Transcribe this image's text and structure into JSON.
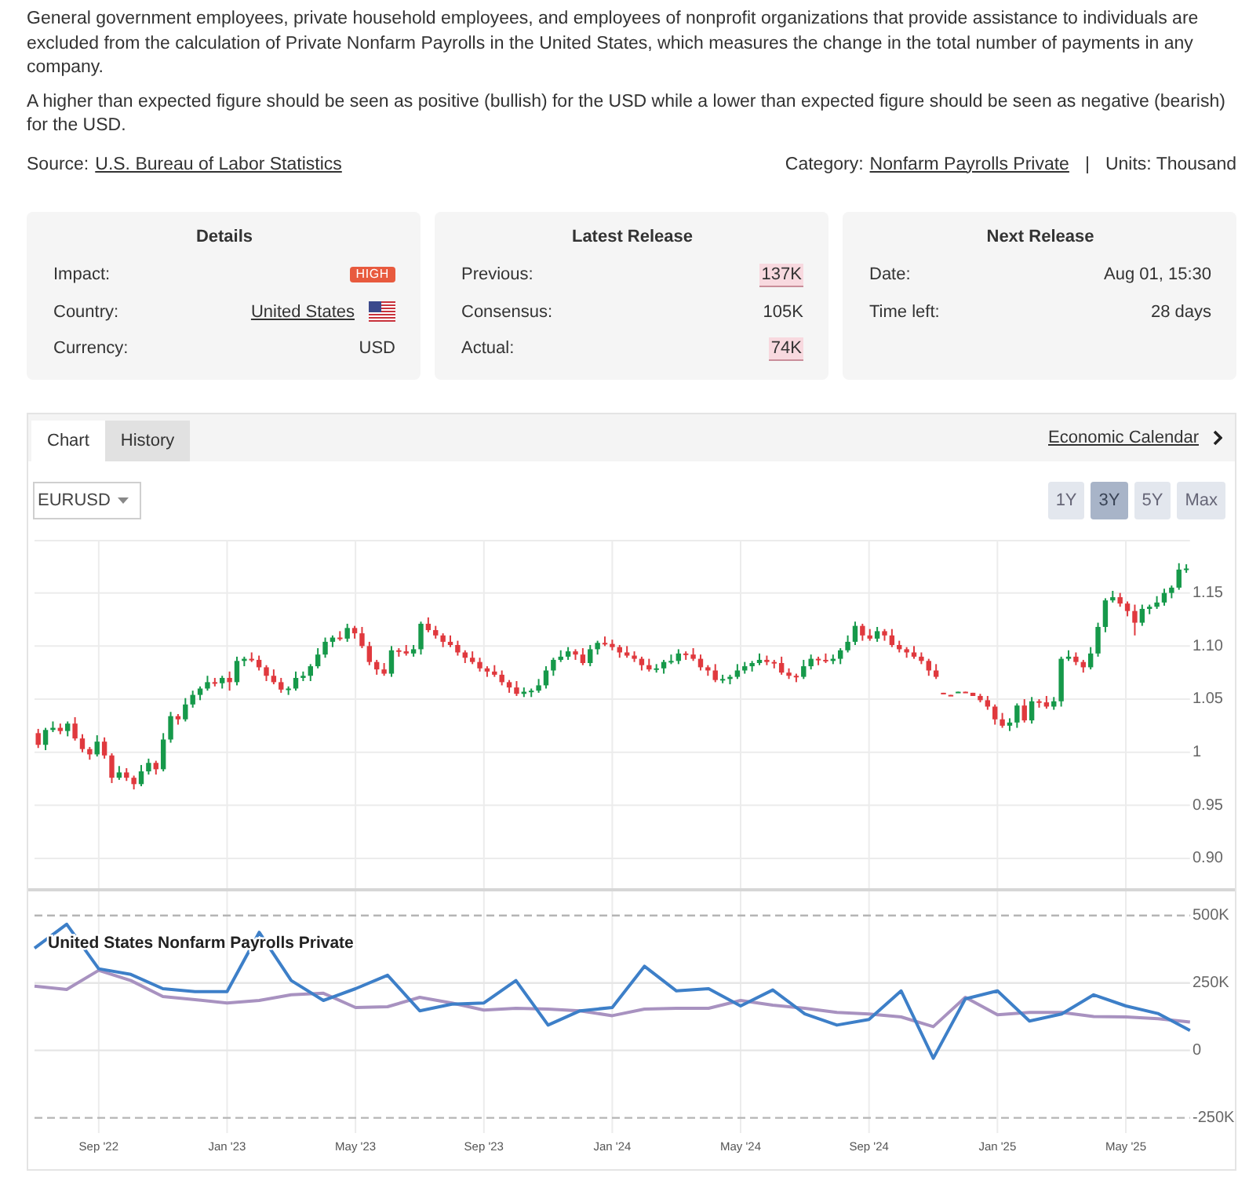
{
  "description": {
    "paragraphs": [
      "General government employees, private household employees, and employees of nonprofit organizations that provide assistance to individuals are excluded from the calculation of Private Nonfarm Payrolls in the United States, which measures the change in the total number of payments in any company.",
      "A higher than expected figure should be seen as positive (bullish) for the USD while a lower than expected figure should be seen as negative (bearish) for the USD."
    ],
    "source": {
      "label": "Source:",
      "link": "U.S. Bureau of Labor Statistics"
    },
    "category": {
      "label": "Category:",
      "link": "Nonfarm Payrolls Private"
    },
    "separator": "|",
    "units": "Units: Thousand"
  },
  "cards": [
    {
      "title": "Details",
      "rows": [
        {
          "label": "Impact:",
          "kind": "badge",
          "value": "HIGH"
        },
        {
          "label": "Country:",
          "kind": "flag_link",
          "value": "United States"
        },
        {
          "label": "Currency:",
          "kind": "text",
          "value": "USD"
        }
      ]
    },
    {
      "title": "Latest Release",
      "rows": [
        {
          "label": "Previous:",
          "kind": "highlight",
          "value": "137K"
        },
        {
          "label": "Consensus:",
          "kind": "text",
          "value": "105K"
        },
        {
          "label": "Actual:",
          "kind": "highlight",
          "value": "74K"
        }
      ]
    },
    {
      "title": "Next Release",
      "rows": [
        {
          "label": "Date:",
          "kind": "text",
          "value": "Aug 01, 15:30"
        },
        {
          "label": "Time left:",
          "kind": "text",
          "value": "28 days"
        }
      ]
    }
  ],
  "chart_panel": {
    "tabs": [
      {
        "label": "Chart",
        "selected": true
      },
      {
        "label": "History",
        "selected": false
      }
    ],
    "calendar_link": "Economic Calendar",
    "symbol_select": {
      "value": "EURUSD"
    },
    "ranges": [
      {
        "label": "1Y",
        "selected": false
      },
      {
        "label": "3Y",
        "selected": true
      },
      {
        "label": "5Y",
        "selected": false
      },
      {
        "label": "Max",
        "selected": false
      }
    ],
    "price_chart": {
      "chart_data": {
        "type": "candlestick",
        "grid": true,
        "categories": [
          null,
          null,
          null,
          null,
          null,
          null,
          null,
          null,
          null,
          null,
          null,
          null,
          null,
          null,
          null,
          null,
          null,
          null,
          null,
          null,
          null,
          null,
          null,
          null,
          null,
          null,
          null,
          null,
          null,
          null,
          null,
          null,
          null,
          null,
          null,
          null,
          null,
          null,
          null,
          null,
          null,
          null,
          null,
          null,
          null,
          null,
          null,
          null,
          null,
          null,
          null,
          null,
          null,
          null,
          null,
          null,
          null,
          null,
          null,
          null,
          null,
          null,
          null,
          null,
          null,
          null,
          null,
          null,
          null,
          null,
          null,
          null,
          null,
          null,
          null,
          null,
          null,
          null,
          null,
          null,
          null,
          null,
          null,
          null,
          null,
          null,
          null,
          null,
          null,
          null,
          null,
          null,
          null,
          null,
          null,
          null,
          null,
          null,
          null,
          null,
          null,
          null,
          null,
          null,
          null,
          null,
          null,
          null,
          null,
          null,
          null,
          null,
          null,
          null,
          null,
          null,
          null,
          null,
          null,
          null,
          null,
          null,
          null,
          null,
          null,
          null,
          null,
          null,
          null,
          null,
          null,
          null,
          null,
          null,
          null,
          null,
          null,
          null,
          null,
          null,
          null,
          null,
          null,
          null,
          null,
          null,
          null,
          null,
          null,
          null,
          null,
          null,
          null,
          null,
          null,
          null,
          null
        ],
        "ohlc": [
          [
            1.018,
            1.022,
            1.004,
            1.007
          ],
          [
            1.007,
            1.023,
            1.002,
            1.021
          ],
          [
            1.021,
            1.029,
            1.019,
            1.023
          ],
          [
            1.023,
            1.027,
            1.017,
            1.02
          ],
          [
            1.02,
            1.029,
            1.015,
            1.027
          ],
          [
            1.027,
            1.033,
            1.011,
            1.013
          ],
          [
            1.013,
            1.017,
            1.0,
            1.003
          ],
          [
            1.003,
            1.005,
            0.993,
            0.998
          ],
          [
            0.998,
            1.016,
            0.996,
            1.01
          ],
          [
            1.01,
            1.014,
            0.994,
            0.997
          ],
          [
            0.997,
            0.999,
            0.971,
            0.976
          ],
          [
            0.976,
            0.987,
            0.974,
            0.981
          ],
          [
            0.981,
            0.985,
            0.973,
            0.976
          ],
          [
            0.976,
            0.978,
            0.965,
            0.97
          ],
          [
            0.97,
            0.988,
            0.968,
            0.982
          ],
          [
            0.982,
            0.994,
            0.979,
            0.99
          ],
          [
            0.99,
            0.992,
            0.979,
            0.984
          ],
          [
            0.984,
            1.018,
            0.982,
            1.012
          ],
          [
            1.012,
            1.038,
            1.009,
            1.034
          ],
          [
            1.034,
            1.036,
            1.026,
            1.031
          ],
          [
            1.031,
            1.051,
            1.029,
            1.045
          ],
          [
            1.045,
            1.058,
            1.042,
            1.054
          ],
          [
            1.054,
            1.062,
            1.049,
            1.06
          ],
          [
            1.06,
            1.072,
            1.058,
            1.066
          ],
          [
            1.066,
            1.07,
            1.062,
            1.065
          ],
          [
            1.065,
            1.072,
            1.06,
            1.07
          ],
          [
            1.07,
            1.076,
            1.058,
            1.066
          ],
          [
            1.066,
            1.09,
            1.063,
            1.086
          ],
          [
            1.086,
            1.09,
            1.081,
            1.088
          ],
          [
            1.088,
            1.094,
            1.085,
            1.087
          ],
          [
            1.087,
            1.091,
            1.077,
            1.08
          ],
          [
            1.08,
            1.082,
            1.067,
            1.072
          ],
          [
            1.072,
            1.078,
            1.064,
            1.066
          ],
          [
            1.066,
            1.07,
            1.056,
            1.059
          ],
          [
            1.059,
            1.062,
            1.054,
            1.06
          ],
          [
            1.06,
            1.076,
            1.058,
            1.07
          ],
          [
            1.07,
            1.076,
            1.067,
            1.072
          ],
          [
            1.072,
            1.083,
            1.067,
            1.081
          ],
          [
            1.081,
            1.098,
            1.079,
            1.092
          ],
          [
            1.092,
            1.108,
            1.089,
            1.104
          ],
          [
            1.104,
            1.11,
            1.099,
            1.108
          ],
          [
            1.108,
            1.114,
            1.105,
            1.107
          ],
          [
            1.107,
            1.121,
            1.104,
            1.117
          ],
          [
            1.117,
            1.119,
            1.107,
            1.112
          ],
          [
            1.112,
            1.118,
            1.098,
            1.1
          ],
          [
            1.1,
            1.104,
            1.082,
            1.085
          ],
          [
            1.085,
            1.087,
            1.073,
            1.078
          ],
          [
            1.078,
            1.084,
            1.072,
            1.074
          ],
          [
            1.074,
            1.1,
            1.071,
            1.096
          ],
          [
            1.096,
            1.098,
            1.09,
            1.095
          ],
          [
            1.095,
            1.101,
            1.091,
            1.093
          ],
          [
            1.093,
            1.101,
            1.09,
            1.097
          ],
          [
            1.097,
            1.123,
            1.092,
            1.121
          ],
          [
            1.121,
            1.127,
            1.113,
            1.115
          ],
          [
            1.115,
            1.119,
            1.107,
            1.11
          ],
          [
            1.11,
            1.112,
            1.099,
            1.104
          ],
          [
            1.104,
            1.11,
            1.099,
            1.101
          ],
          [
            1.101,
            1.105,
            1.091,
            1.094
          ],
          [
            1.094,
            1.096,
            1.084,
            1.089
          ],
          [
            1.089,
            1.095,
            1.083,
            1.085
          ],
          [
            1.085,
            1.089,
            1.076,
            1.079
          ],
          [
            1.079,
            1.081,
            1.071,
            1.076
          ],
          [
            1.076,
            1.082,
            1.071,
            1.073
          ],
          [
            1.073,
            1.077,
            1.063,
            1.066
          ],
          [
            1.066,
            1.068,
            1.056,
            1.061
          ],
          [
            1.061,
            1.067,
            1.053,
            1.055
          ],
          [
            1.055,
            1.061,
            1.052,
            1.057
          ],
          [
            1.057,
            1.06,
            1.052,
            1.058
          ],
          [
            1.058,
            1.069,
            1.056,
            1.063
          ],
          [
            1.063,
            1.081,
            1.06,
            1.077
          ],
          [
            1.077,
            1.089,
            1.072,
            1.087
          ],
          [
            1.087,
            1.096,
            1.085,
            1.09
          ],
          [
            1.09,
            1.099,
            1.087,
            1.095
          ],
          [
            1.095,
            1.097,
            1.087,
            1.092
          ],
          [
            1.092,
            1.098,
            1.082,
            1.084
          ],
          [
            1.084,
            1.101,
            1.081,
            1.097
          ],
          [
            1.097,
            1.105,
            1.092,
            1.103
          ],
          [
            1.103,
            1.109,
            1.1,
            1.102
          ],
          [
            1.102,
            1.106,
            1.096,
            1.099
          ],
          [
            1.099,
            1.101,
            1.089,
            1.094
          ],
          [
            1.094,
            1.1,
            1.089,
            1.091
          ],
          [
            1.091,
            1.095,
            1.085,
            1.088
          ],
          [
            1.088,
            1.09,
            1.077,
            1.082
          ],
          [
            1.082,
            1.088,
            1.076,
            1.078
          ],
          [
            1.078,
            1.083,
            1.075,
            1.079
          ],
          [
            1.079,
            1.087,
            1.074,
            1.085
          ],
          [
            1.085,
            1.092,
            1.083,
            1.086
          ],
          [
            1.086,
            1.097,
            1.083,
            1.093
          ],
          [
            1.093,
            1.095,
            1.087,
            1.092
          ],
          [
            1.092,
            1.098,
            1.086,
            1.088
          ],
          [
            1.088,
            1.092,
            1.077,
            1.08
          ],
          [
            1.08,
            1.082,
            1.072,
            1.077
          ],
          [
            1.077,
            1.083,
            1.066,
            1.068
          ],
          [
            1.068,
            1.073,
            1.065,
            1.069
          ],
          [
            1.069,
            1.073,
            1.064,
            1.071
          ],
          [
            1.071,
            1.083,
            1.069,
            1.077
          ],
          [
            1.077,
            1.085,
            1.074,
            1.081
          ],
          [
            1.081,
            1.086,
            1.076,
            1.084
          ],
          [
            1.084,
            1.093,
            1.082,
            1.087
          ],
          [
            1.087,
            1.091,
            1.082,
            1.085
          ],
          [
            1.085,
            1.087,
            1.079,
            1.084
          ],
          [
            1.084,
            1.09,
            1.073,
            1.075
          ],
          [
            1.075,
            1.079,
            1.069,
            1.072
          ],
          [
            1.072,
            1.074,
            1.066,
            1.071
          ],
          [
            1.071,
            1.087,
            1.069,
            1.081
          ],
          [
            1.081,
            1.092,
            1.078,
            1.088
          ],
          [
            1.088,
            1.09,
            1.082,
            1.087
          ],
          [
            1.087,
            1.093,
            1.084,
            1.086
          ],
          [
            1.086,
            1.092,
            1.083,
            1.088
          ],
          [
            1.088,
            1.098,
            1.083,
            1.096
          ],
          [
            1.096,
            1.11,
            1.094,
            1.104
          ],
          [
            1.104,
            1.123,
            1.101,
            1.119
          ],
          [
            1.119,
            1.121,
            1.105,
            1.11
          ],
          [
            1.11,
            1.116,
            1.105,
            1.107
          ],
          [
            1.107,
            1.118,
            1.104,
            1.114
          ],
          [
            1.114,
            1.116,
            1.105,
            1.11
          ],
          [
            1.11,
            1.116,
            1.099,
            1.101
          ],
          [
            1.101,
            1.105,
            1.094,
            1.097
          ],
          [
            1.097,
            1.099,
            1.089,
            1.094
          ],
          [
            1.094,
            1.1,
            1.088,
            1.09
          ],
          [
            1.09,
            1.094,
            1.083,
            1.086
          ],
          [
            1.086,
            1.088,
            1.072,
            1.077
          ],
          [
            1.077,
            1.083,
            1.069,
            1.071
          ],
          [
            1.056,
            1.056,
            1.055,
            1.055
          ],
          [
            1.054,
            1.054,
            1.053,
            1.053
          ],
          [
            1.056,
            1.057,
            1.056,
            1.057
          ],
          [
            1.057,
            1.057,
            1.056,
            1.056
          ],
          [
            1.056,
            1.056,
            1.053,
            1.053
          ],
          [
            1.053,
            1.055,
            1.047,
            1.049
          ],
          [
            1.049,
            1.053,
            1.04,
            1.043
          ],
          [
            1.043,
            1.045,
            1.026,
            1.031
          ],
          [
            1.031,
            1.037,
            1.023,
            1.025
          ],
          [
            1.025,
            1.032,
            1.02,
            1.028
          ],
          [
            1.028,
            1.046,
            1.023,
            1.044
          ],
          [
            1.044,
            1.05,
            1.028,
            1.03
          ],
          [
            1.03,
            1.052,
            1.027,
            1.048
          ],
          [
            1.048,
            1.05,
            1.042,
            1.047
          ],
          [
            1.047,
            1.053,
            1.041,
            1.043
          ],
          [
            1.043,
            1.052,
            1.04,
            1.048
          ],
          [
            1.048,
            1.09,
            1.043,
            1.088
          ],
          [
            1.088,
            1.096,
            1.086,
            1.09
          ],
          [
            1.09,
            1.094,
            1.082,
            1.085
          ],
          [
            1.085,
            1.087,
            1.075,
            1.08
          ],
          [
            1.08,
            1.099,
            1.078,
            1.093
          ],
          [
            1.093,
            1.122,
            1.09,
            1.118
          ],
          [
            1.118,
            1.145,
            1.113,
            1.143
          ],
          [
            1.143,
            1.152,
            1.141,
            1.146
          ],
          [
            1.146,
            1.15,
            1.137,
            1.14
          ],
          [
            1.14,
            1.142,
            1.128,
            1.133
          ],
          [
            1.133,
            1.139,
            1.11,
            1.122
          ],
          [
            1.122,
            1.139,
            1.119,
            1.135
          ],
          [
            1.135,
            1.139,
            1.13,
            1.137
          ],
          [
            1.137,
            1.147,
            1.135,
            1.141
          ],
          [
            1.141,
            1.154,
            1.138,
            1.15
          ],
          [
            1.15,
            1.157,
            1.145,
            1.155
          ],
          [
            1.155,
            1.178,
            1.153,
            1.172
          ],
          [
            1.172,
            1.177,
            1.169,
            1.173
          ]
        ],
        "ylim": [
          0.869,
          1.2
        ],
        "yticks": [
          {
            "value": 1.15,
            "label": "1.15"
          },
          {
            "value": 1.1,
            "label": "1.10"
          },
          {
            "value": 1.05,
            "label": "1.05"
          },
          {
            "value": 1,
            "label": "1"
          },
          {
            "value": 0.95,
            "label": "0.95"
          },
          {
            "value": 0.9,
            "label": "0.90"
          }
        ]
      }
    },
    "payrolls_chart": {
      "chart_data": {
        "type": "line",
        "title": "United States Nonfarm Payrolls Private",
        "grid": true,
        "categories": [
          null,
          null,
          "Sep '22",
          null,
          null,
          null,
          "Jan '23",
          null,
          null,
          null,
          "May '23",
          null,
          null,
          null,
          "Sep '23",
          null,
          null,
          null,
          "Jan '24",
          null,
          null,
          null,
          "May '24",
          null,
          null,
          null,
          "Sep '24",
          null,
          null,
          null,
          "Jan '25",
          null,
          null,
          null,
          "May '25",
          null,
          null
        ],
        "series": [
          {
            "color": "#3d7fc8",
            "values": [
              379,
              468,
              303,
              282,
              229,
              218,
              218,
              438,
              259,
              185,
              229,
              279,
              147,
              171,
              176,
              259,
              94,
              147,
              159,
              312,
              221,
              229,
              165,
              224,
              135,
              94,
              115,
              221,
              -29,
              191,
              221,
              109,
              135,
              206,
              165,
              137,
              74
            ]
          },
          {
            "color": "#a892c0",
            "values": [
              238,
              226,
              297,
              259,
              200,
              188,
              176,
              185,
              206,
              212,
              159,
              162,
              197,
              176,
              150,
              156,
              153,
              147,
              129,
              153,
              156,
              156,
              185,
              168,
              156,
              141,
              135,
              124,
              88,
              197,
              132,
              141,
              141,
              126,
              124,
              118,
              105
            ]
          }
        ],
        "ylim": [
          -250,
          500
        ],
        "yticks": [
          {
            "value": 500,
            "label": "500K"
          },
          {
            "value": 250,
            "label": "250K"
          },
          {
            "value": 0,
            "label": "0"
          },
          {
            "value": -250,
            "label": "-250K"
          }
        ]
      }
    }
  }
}
